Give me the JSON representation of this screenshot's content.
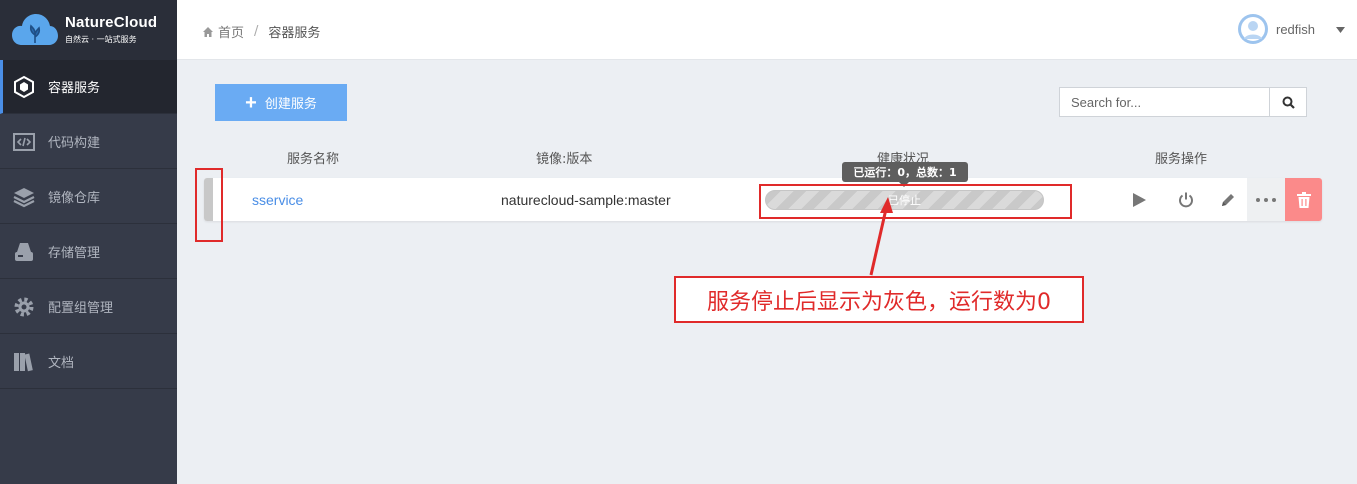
{
  "brand": {
    "title": "NatureCloud",
    "subtitle": "自然云 · 一站式服务"
  },
  "sidebar": {
    "items": [
      {
        "label": "容器服务",
        "icon": "container-icon",
        "active": true
      },
      {
        "label": "代码构建",
        "icon": "code-icon",
        "active": false
      },
      {
        "label": "镜像仓库",
        "icon": "layers-icon",
        "active": false
      },
      {
        "label": "存储管理",
        "icon": "storage-icon",
        "active": false
      },
      {
        "label": "配置组管理",
        "icon": "gear-icon",
        "active": false
      },
      {
        "label": "文档",
        "icon": "books-icon",
        "active": false
      }
    ]
  },
  "header": {
    "breadcrumb": {
      "home": "首页",
      "separator": "/",
      "current": "容器服务"
    },
    "user": {
      "name": "redfish"
    }
  },
  "toolbar": {
    "create_label": "创建服务",
    "search_placeholder": "Search for..."
  },
  "table": {
    "columns": [
      "服务名称",
      "镜像:版本",
      "健康状况",
      "服务操作"
    ],
    "rows": [
      {
        "name": "sservice",
        "image": "naturecloud-sample:master",
        "health_text": "已停止",
        "tooltip": "已运行：0，总数：1"
      }
    ]
  },
  "annotation": {
    "text": "服务停止后显示为灰色，运行数为0"
  },
  "colors": {
    "accent": "#4a8ee6",
    "button": "#6aabf3",
    "danger": "#fb8a8a",
    "annotation": "#e02a2a",
    "sidebar": "#363b49"
  }
}
